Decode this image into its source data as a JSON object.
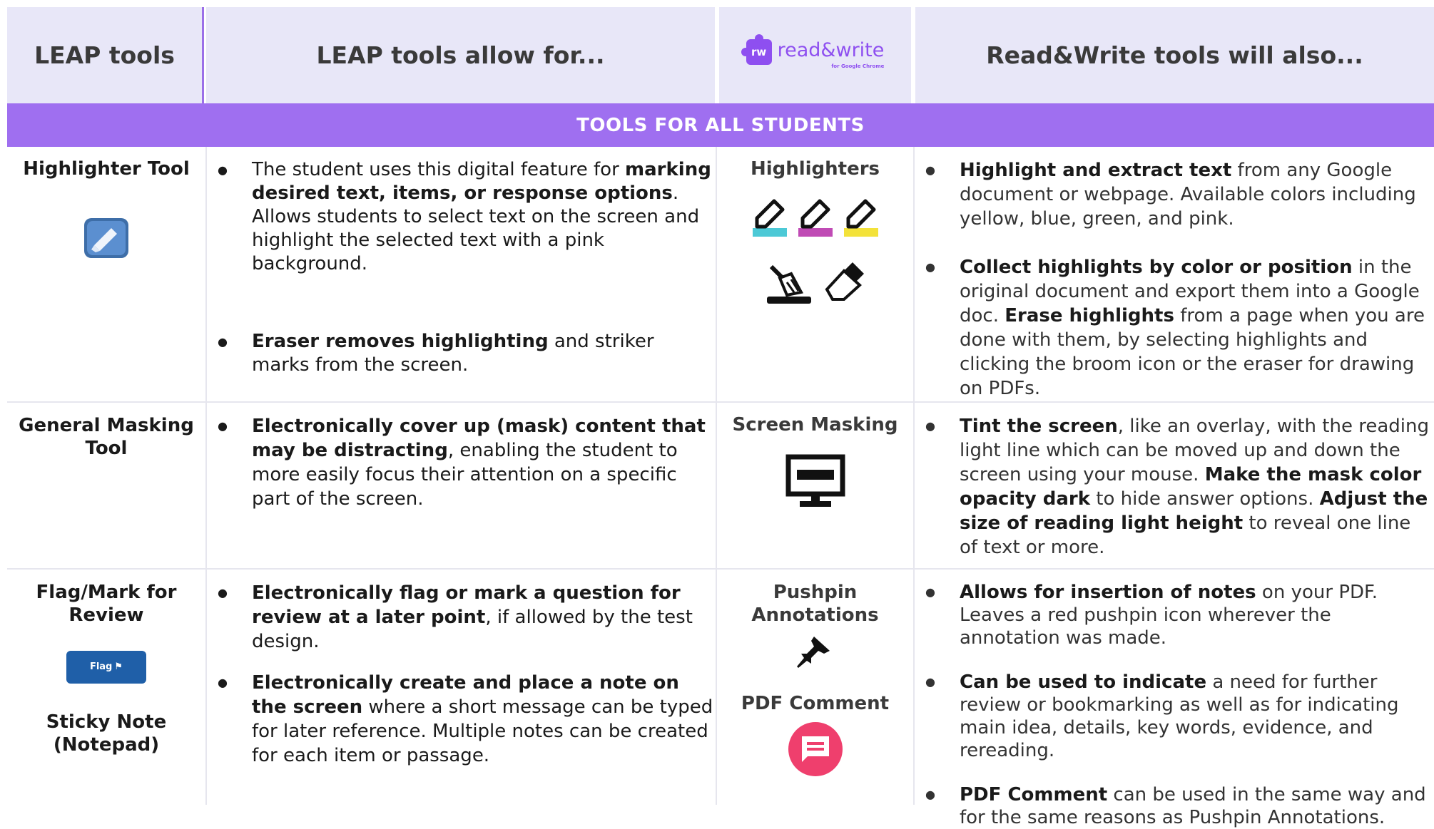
{
  "header": {
    "col1": "LEAP tools",
    "col2": "LEAP tools allow for...",
    "logo_badge": "rw",
    "logo_text": "read&write",
    "logo_sub": "for Google Chrome",
    "col4": "Read&Write tools will also..."
  },
  "banner": "TOOLS FOR ALL STUDENTS",
  "rows": [
    {
      "leap_tool": "Highlighter Tool",
      "allow": [
        {
          "pre": "The student uses this digital feature for ",
          "bold": "marking desired text, items, or response options",
          "post": ". Allows students to select text on the screen and highlight the selected text with a pink background."
        },
        {
          "pre": "",
          "bold": "Eraser removes highlighting",
          "post": " and striker marks from the screen."
        }
      ],
      "rw_tool": "Highlighters",
      "rw": [
        {
          "bold": "Highlight and extract text",
          "post": " from any Google document or webpage. Available colors including yellow, blue, green, and pink."
        },
        {
          "bold": "Collect highlights by color or position",
          "post": " in the original document and export them into a Google doc.  ",
          "bold2": "Erase highlights",
          "post2": " from a page when you are done with them, by selecting highlights and clicking the broom icon or the eraser for drawing on PDFs."
        }
      ],
      "highlighter_colors": [
        "#4cc9d6",
        "#c04bb5",
        "#f3e23a"
      ]
    },
    {
      "leap_tool": "General Masking Tool",
      "allow": [
        {
          "pre": "",
          "bold": "Electronically cover up (mask) content that may be distracting",
          "post": ", enabling the student to more easily focus their attention on a specific part of the screen."
        }
      ],
      "rw_tool": "Screen Masking",
      "rw": [
        {
          "bold": "Tint the screen",
          "post": ", like an overlay, with the reading light line which can be moved up and down the screen using your mouse.  ",
          "bold2": "Make the mask color opacity dark",
          "post2": " to hide answer options.  ",
          "bold3": "Adjust the size of reading light height",
          "post3": " to reveal one line of text or more."
        }
      ]
    },
    {
      "leap_tool": "Flag/Mark for Review",
      "flag_label": "Flag",
      "leap_tool2": "Sticky Note (Notepad)",
      "allow": [
        {
          "pre": "",
          "bold": "Electronically flag or mark a question for review at a later point",
          "post": ", if allowed by the test design."
        },
        {
          "pre": "",
          "bold": "Electronically create and place a note on the screen",
          "post": " where a short message can be typed for later reference.  Multiple notes can be created for each item or passage."
        }
      ],
      "rw_tool": "Pushpin Annotations",
      "rw_tool2": "PDF Comment",
      "rw": [
        {
          "bold": "Allows for insertion of notes",
          "post": " on your PDF. Leaves a red pushpin icon wherever the annotation was made."
        },
        {
          "bold": "Can be used to indicate",
          "post": " a need for further review or bookmarking as well as for indicating main idea, details, key words, evidence, and rereading."
        },
        {
          "bold": "PDF Comment",
          "post": " can be used in the same way and for the same reasons as Pushpin Annotations."
        }
      ]
    }
  ],
  "colors": {
    "accent": "#9f6ff0",
    "header_bg": "#e8e7f8",
    "comment_pink": "#ef3f6d"
  }
}
